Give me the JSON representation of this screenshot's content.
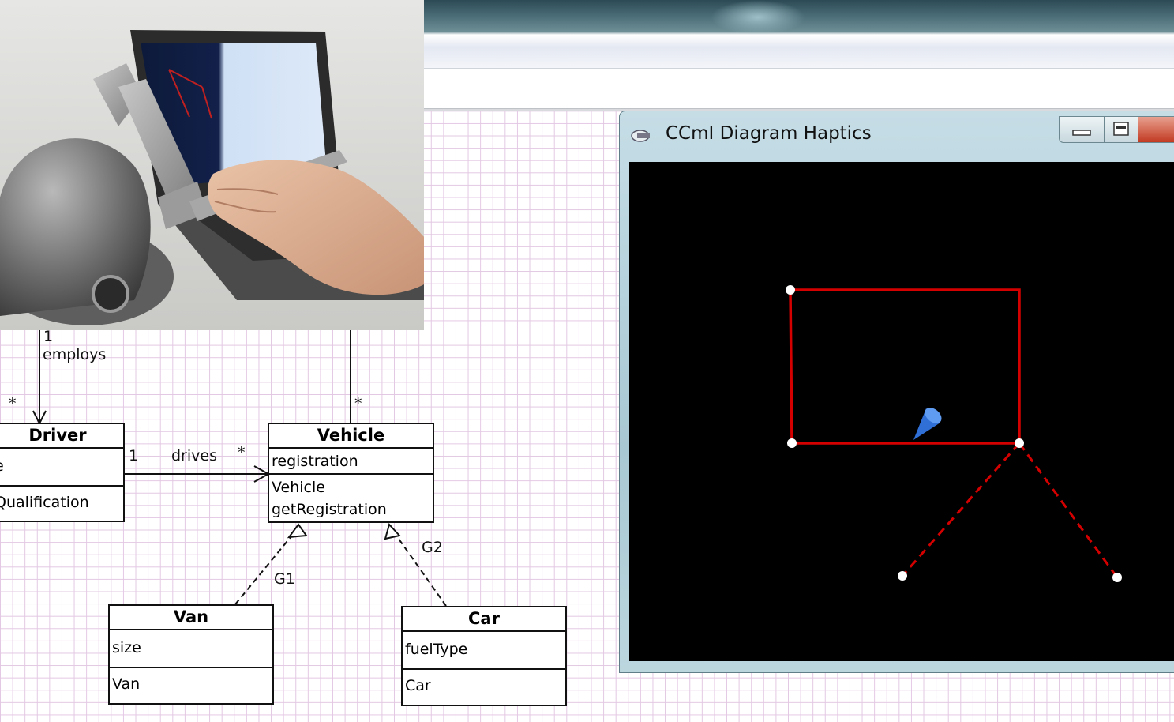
{
  "haptic_window": {
    "title": "CCmI Diagram Haptics",
    "buttons": [
      "minimize",
      "maximize",
      "close"
    ]
  },
  "uml": {
    "classes": {
      "driver": {
        "name": "Driver",
        "attributes": [
          "e"
        ],
        "operations": [
          "Qualification"
        ]
      },
      "vehicle": {
        "name": "Vehicle",
        "attributes": [
          "registration"
        ],
        "operations": [
          "Vehicle",
          "getRegistration"
        ]
      },
      "van": {
        "name": "Van",
        "attributes": [
          "size"
        ],
        "operations": [
          "Van"
        ]
      },
      "car": {
        "name": "Car",
        "attributes": [
          "fuelType"
        ],
        "operations": [
          "Car"
        ]
      }
    },
    "labels": {
      "employs_mult_top": "1",
      "employs": "employs",
      "employs_mult_bottom": "*",
      "vehicle_mult_top": "*",
      "drives_mult_left": "1",
      "drives": "drives",
      "drives_mult_right": "*",
      "g1": "G1",
      "g2": "G2"
    }
  },
  "colors": {
    "grid": "#e3c8e3",
    "haptic_line": "#d40000",
    "cursor": "#3d7fe0"
  },
  "icons": [
    "app-icon",
    "minimize-icon",
    "maximize-icon",
    "close-icon",
    "haptic-cursor-icon"
  ]
}
